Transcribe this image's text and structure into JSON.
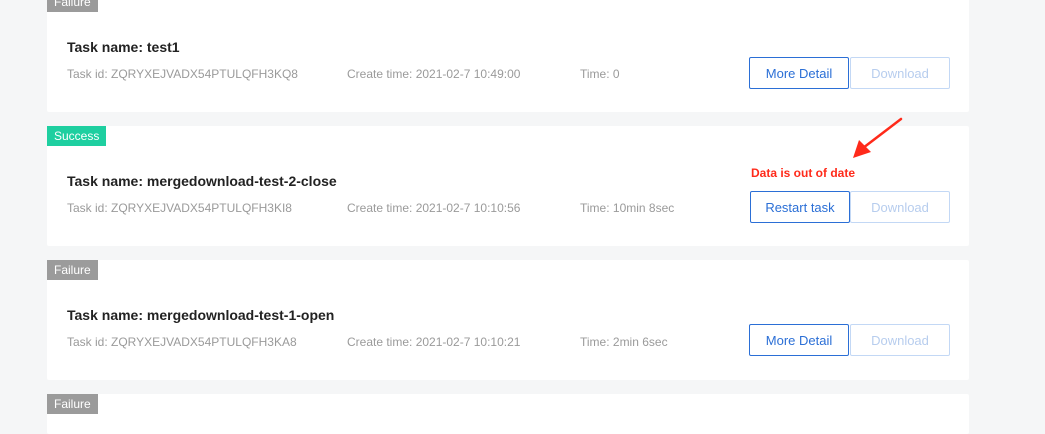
{
  "tasks": [
    {
      "status": "Failure",
      "name": "Task name: test1",
      "id": "Task id: ZQRYXEJVADX54PTULQFH3KQ8",
      "create_time": "Create time: 2021-02-7 10:49:00",
      "time": "Time: 0",
      "action_label": "More Detail",
      "download_label": "Download"
    },
    {
      "status": "Success",
      "name": "Task name: mergedownload-test-2-close",
      "id": "Task id: ZQRYXEJVADX54PTULQFH3KI8",
      "create_time": "Create time: 2021-02-7 10:10:56",
      "time": "Time: 10min 8sec",
      "action_label": "Restart task",
      "download_label": "Download"
    },
    {
      "status": "Failure",
      "name": "Task name: mergedownload-test-1-open",
      "id": "Task id: ZQRYXEJVADX54PTULQFH3KA8",
      "create_time": "Create time: 2021-02-7 10:10:21",
      "time": "Time: 2min 6sec",
      "action_label": "More Detail",
      "download_label": "Download"
    },
    {
      "status": "Failure"
    }
  ],
  "annotation": {
    "text": "Data is out of date",
    "color": "#ff2a1a"
  },
  "colors": {
    "failure_badge": "#9b9b9b",
    "success_badge": "#1ecfa0",
    "primary": "#2b6fd6"
  }
}
